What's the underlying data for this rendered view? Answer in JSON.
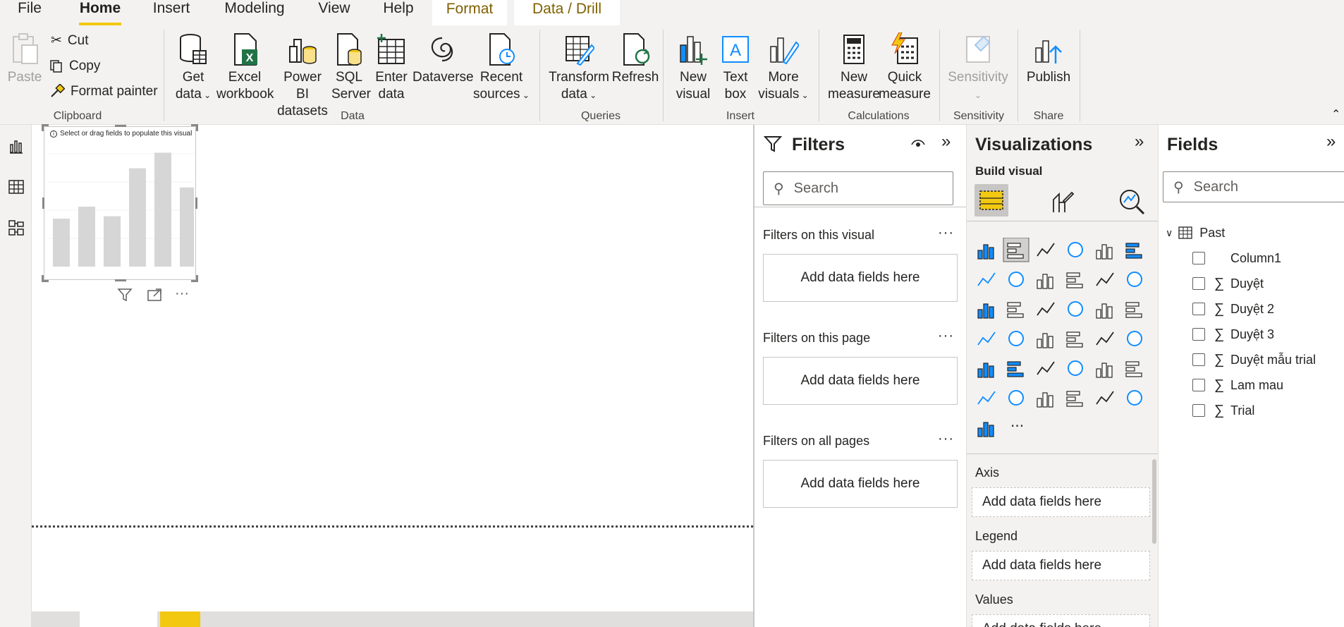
{
  "menu": {
    "tabs": [
      "File",
      "Home",
      "Insert",
      "Modeling",
      "View",
      "Help",
      "Format",
      "Data / Drill"
    ]
  },
  "ribbon": {
    "clipboard": {
      "paste": "Paste",
      "cut": "Cut",
      "copy": "Copy",
      "format_painter": "Format painter",
      "label": "Clipboard"
    },
    "data": {
      "get_data_1": "Get",
      "get_data_2": "data",
      "excel_1": "Excel",
      "excel_2": "workbook",
      "pbi_1": "Power BI",
      "pbi_2": "datasets",
      "sql_1": "SQL",
      "sql_2": "Server",
      "enter_1": "Enter",
      "enter_2": "data",
      "dataverse": "Dataverse",
      "recent_1": "Recent",
      "recent_2": "sources",
      "label": "Data"
    },
    "queries": {
      "transform_1": "Transform",
      "transform_2": "data",
      "refresh": "Refresh",
      "label": "Queries"
    },
    "insert": {
      "new_visual_1": "New",
      "new_visual_2": "visual",
      "text_box_1": "Text",
      "text_box_2": "box",
      "more_visuals_1": "More",
      "more_visuals_2": "visuals",
      "label": "Insert"
    },
    "calculations": {
      "new_measure_1": "New",
      "new_measure_2": "measure",
      "quick_measure_1": "Quick",
      "quick_measure_2": "measure",
      "label": "Calculations"
    },
    "sensitivity": {
      "btn": "Sensitivity",
      "label": "Sensitivity"
    },
    "share": {
      "publish": "Publish",
      "label": "Share"
    }
  },
  "visual_placeholder": {
    "hint": "Select or drag fields to populate this visual"
  },
  "placeholder_chart": {
    "type": "bar",
    "values": [
      40,
      50,
      42,
      82,
      95,
      66
    ]
  },
  "filters": {
    "title": "Filters",
    "search_placeholder": "Search",
    "sections": [
      {
        "title": "Filters on this visual",
        "well": "Add data fields here"
      },
      {
        "title": "Filters on this page",
        "well": "Add data fields here"
      },
      {
        "title": "Filters on all pages",
        "well": "Add data fields here"
      }
    ]
  },
  "visualizations": {
    "title": "Visualizations",
    "subtitle": "Build visual",
    "wells": [
      {
        "title": "Axis",
        "placeholder": "Add data fields here"
      },
      {
        "title": "Legend",
        "placeholder": "Add data fields here"
      },
      {
        "title": "Values",
        "placeholder": "Add data fields here"
      }
    ],
    "more": "···"
  },
  "fields": {
    "title": "Fields",
    "search_placeholder": "Search",
    "table": "Past",
    "items": [
      {
        "name": "Column1",
        "sigma": false
      },
      {
        "name": "Duyệt",
        "sigma": true
      },
      {
        "name": "Duyệt 2",
        "sigma": true
      },
      {
        "name": "Duyệt 3",
        "sigma": true
      },
      {
        "name": "Duyệt mẫu trial",
        "sigma": true
      },
      {
        "name": "Lam mau",
        "sigma": true
      },
      {
        "name": "Trial",
        "sigma": true
      }
    ]
  },
  "colors": {
    "accent": "#f2c811",
    "blue": "#118dff",
    "green": "#217346"
  }
}
